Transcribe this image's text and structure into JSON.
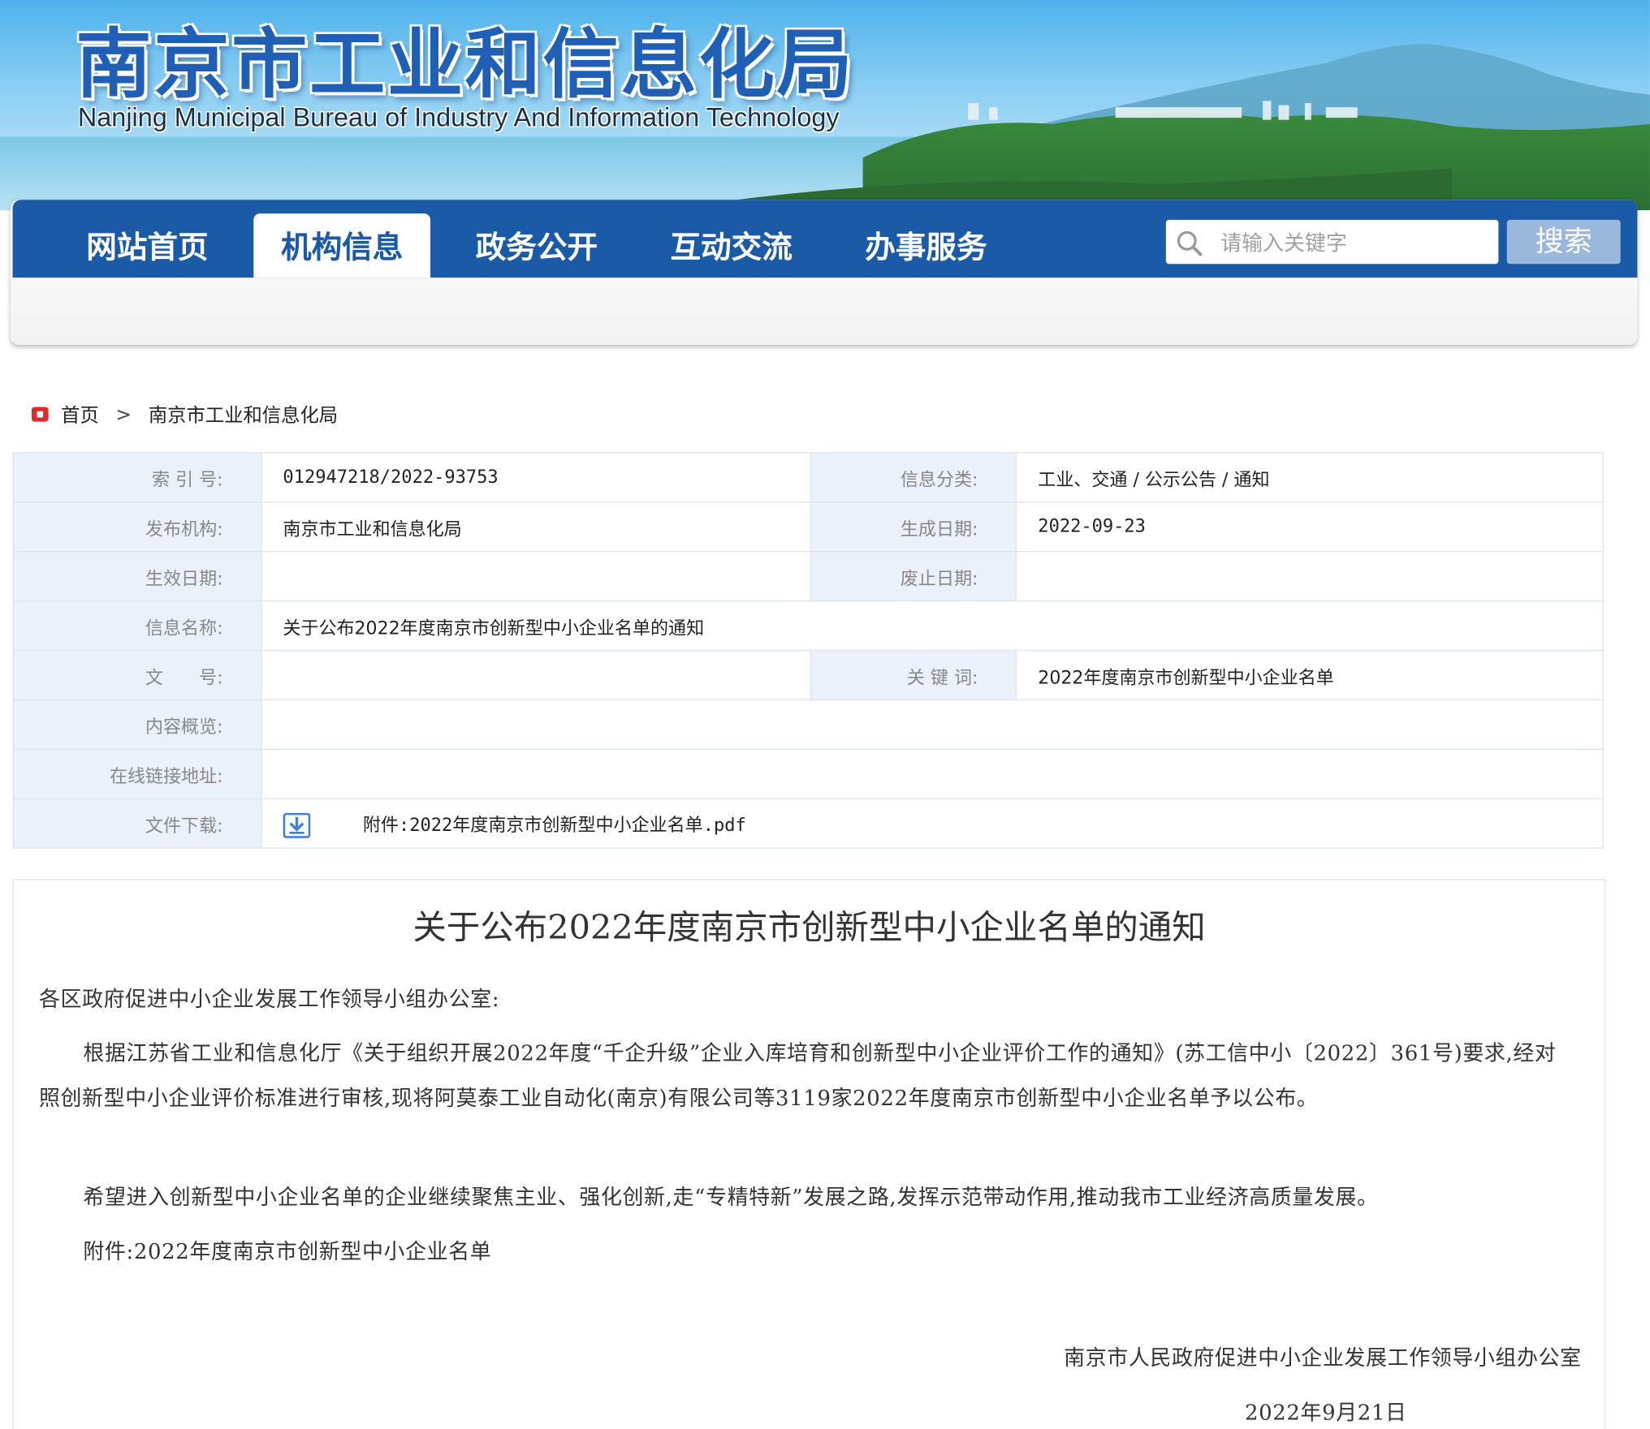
{
  "header": {
    "title": "南京市工业和信息化局",
    "subtitle": "Nanjing Municipal Bureau of Industry And Information Technology"
  },
  "nav": {
    "items": [
      {
        "label": "网站首页",
        "active": false
      },
      {
        "label": "机构信息",
        "active": true
      },
      {
        "label": "政务公开",
        "active": false
      },
      {
        "label": "互动交流",
        "active": false
      },
      {
        "label": "办事服务",
        "active": false
      }
    ],
    "search_placeholder": "请输入关键字",
    "search_button": "搜索"
  },
  "breadcrumb": {
    "home": "首页",
    "current": "南京市工业和信息化局"
  },
  "info": {
    "index_label": "索 引 号:",
    "index_value": "012947218/2022-93753",
    "category_label": "信息分类:",
    "category_value": "工业、交通 / 公示公告 / 通知",
    "publisher_label": "发布机构:",
    "publisher_value": "南京市工业和信息化局",
    "created_label": "生成日期:",
    "created_value": "2022-09-23",
    "effective_label": "生效日期:",
    "effective_value": "",
    "abolish_label": "废止日期:",
    "abolish_value": "",
    "name_label": "信息名称:",
    "name_value": "关于公布2022年度南京市创新型中小企业名单的通知",
    "doc_no_label": "文　　号:",
    "doc_no_value": "",
    "keywords_label": "关 键 词:",
    "keywords_value": "2022年度南京市创新型中小企业名单",
    "summary_label": "内容概览:",
    "summary_value": "",
    "link_label": "在线链接地址:",
    "link_value": "",
    "download_label": "文件下载:",
    "download_value": "附件:2022年度南京市创新型中小企业名单.pdf"
  },
  "article": {
    "title": "关于公布2022年度南京市创新型中小企业名单的通知",
    "salutation": "各区政府促进中小企业发展工作领导小组办公室:",
    "paragraph1": "根据江苏省工业和信息化厅《关于组织开展2022年度“千企升级”企业入库培育和创新型中小企业评价工作的通知》(苏工信中小〔2022〕361号)要求,经对照创新型中小企业评价标准进行审核,现将阿莫泰工业自动化(南京)有限公司等3119家2022年度南京市创新型中小企业名单予以公布。",
    "paragraph2": "希望进入创新型中小企业名单的企业继续聚焦主业、强化创新,走“专精特新”发展之路,发挥示范带动作用,推动我市工业经济高质量发展。",
    "attachment": "附件:2022年度南京市创新型中小企业名单",
    "signature": "南京市人民政府促进中小企业发展工作领导小组办公室",
    "date": "2022年9月21日"
  },
  "colors": {
    "nav_blue": "#1a5aa6",
    "title_blue": "#1f5fb5",
    "label_bg": "#eaf1fa",
    "search_button_bg": "#9ab8dc",
    "breadcrumb_icon": "#e02b2b"
  },
  "icons": {
    "search": "search-icon",
    "home": "home-icon",
    "download": "download-icon"
  }
}
